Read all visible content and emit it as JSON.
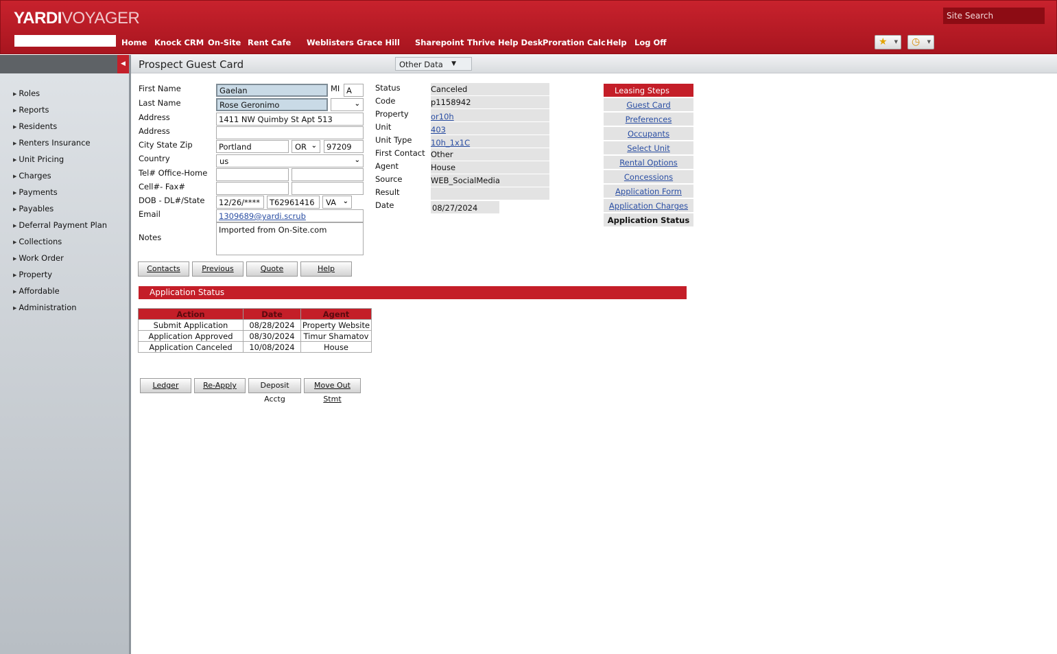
{
  "header": {
    "logo_bold": "YARDI",
    "logo_light": "VOYAGER",
    "site_search": "Site Search",
    "nav": [
      "Home",
      "Knock CRM",
      "On-Site",
      "Rent Cafe",
      "Weblisters",
      "Grace Hill",
      "Sharepoint",
      "Thrive Help Desk",
      "Proration Calc",
      "Help",
      "Log Off"
    ],
    "favorites_icon": "star-icon",
    "history_icon": "clock-icon"
  },
  "sidebar": {
    "items": [
      "Roles",
      "Reports",
      "Residents",
      "Renters Insurance",
      "Unit Pricing",
      "Charges",
      "Payments",
      "Payables",
      "Deferral Payment Plan",
      "Collections",
      "Work Order",
      "Property",
      "Affordable",
      "Administration"
    ]
  },
  "page": {
    "title": "Prospect Guest Card",
    "other_data": "Other Data"
  },
  "form": {
    "labels": {
      "first_name": "First Name",
      "mi": "MI",
      "last_name": "Last Name",
      "address1": "Address",
      "address2": "Address",
      "city_state_zip": "City State Zip",
      "country": "Country",
      "tel": "Tel# Office-Home",
      "cell": "Cell#- Fax#",
      "dob": "DOB - DL#/State",
      "email": "Email",
      "notes": "Notes"
    },
    "values": {
      "first_name": "Gaelan",
      "mi": "A",
      "last_name": "Rose Geronimo",
      "last_name_suffix": "",
      "address1": "1411 NW Quimby St Apt 513",
      "address2": "",
      "city": "Portland",
      "state": "OR",
      "zip": "97209",
      "country": "us",
      "tel_office": "",
      "tel_home": "",
      "cell": "",
      "fax": "",
      "dob": "12/26/****",
      "dl": "T62961416",
      "dl_state": "VA",
      "email": "1309689@yardi.scrub",
      "notes": "Imported from On-Site.com"
    }
  },
  "info": {
    "labels": [
      "Status",
      "Code",
      "Property",
      "Unit",
      "Unit Type",
      "First Contact",
      "Agent",
      "Source",
      "Result",
      "Date"
    ],
    "values": {
      "status": "Canceled",
      "code": "p1158942",
      "property": "or10h",
      "unit": "403",
      "unit_type": "10h_1x1C",
      "first_contact": "Other",
      "agent": "House",
      "source": "WEB_SocialMedia",
      "result": "",
      "date": "08/27/2024"
    }
  },
  "buttons": {
    "contacts": "Contacts",
    "previous": "Previous",
    "quote": "Quote",
    "help": "Help",
    "ledger": "Ledger",
    "reapply": "Re-Apply",
    "deposit": "Deposit Acctg",
    "moveout": "Move Out Stmt"
  },
  "application_status": {
    "title": "Application Status",
    "headers": [
      "Action",
      "Date",
      "Agent"
    ],
    "rows": [
      [
        "Submit Application",
        "08/28/2024",
        "Property Website"
      ],
      [
        "Application Approved",
        "08/30/2024",
        "Timur Shamatov"
      ],
      [
        "Application Canceled",
        "10/08/2024",
        "House"
      ]
    ]
  },
  "leasing_steps": {
    "title": "Leasing Steps",
    "items": [
      "Guest Card",
      "Preferences",
      "Occupants",
      "Select Unit",
      "Rental Options",
      "Concessions",
      "Application Form",
      "Application Charges",
      "Application Status"
    ],
    "active": "Application Status"
  },
  "colors": {
    "brand_red": "#c41e28",
    "link_blue": "#2a4ea3"
  }
}
